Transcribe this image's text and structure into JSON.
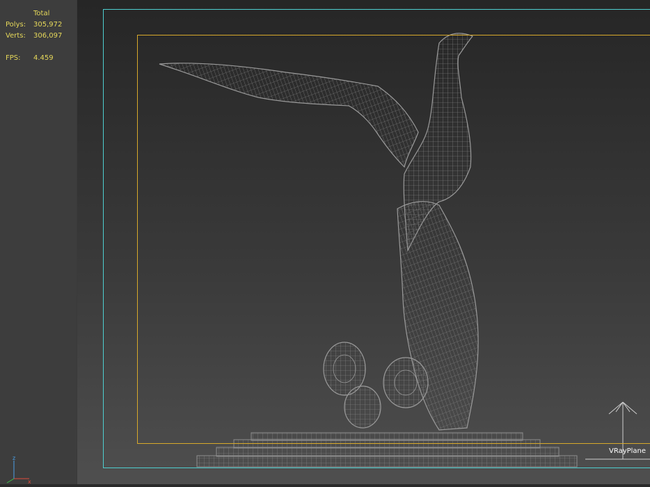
{
  "stats": {
    "header": "Total",
    "polys_label": "Polys:",
    "polys_value": "305,972",
    "verts_label": "Verts:",
    "verts_value": "306,097",
    "fps_label": "FPS:",
    "fps_value": "4.459"
  },
  "viewport": {
    "object_label": "VRayPlane"
  },
  "gizmo": {
    "z": "z",
    "x": "x"
  },
  "colors": {
    "stats_text": "#e6d85a",
    "safe_frame": "#4ecfd0",
    "render_frame": "#d8a92a",
    "wireframe": "#9a9a9a",
    "label_text": "#ffffff"
  },
  "icons": {
    "light": "vray-plane-light-icon",
    "axis": "axis-tripod-icon"
  }
}
